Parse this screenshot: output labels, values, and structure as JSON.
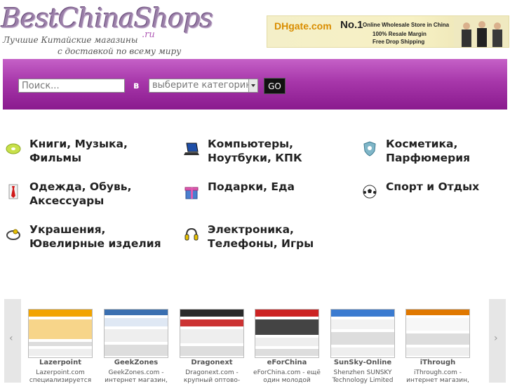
{
  "header": {
    "logo_title": "BestChinaShops",
    "logo_suffix": ".ru",
    "tagline_line1": "Лучшие Китайские магазины",
    "tagline_line2": "с доставкой по всему миру",
    "banner": {
      "brand": "DHgate.com",
      "rank": "No.1",
      "line1": "Online Wholesale Store in China",
      "line2": "100% Resale Margin",
      "line3": "Free Drop Shipping"
    }
  },
  "search": {
    "placeholder": "Поиск...",
    "in_label": "в",
    "category_placeholder": "выберите категорию",
    "go_label": "GO"
  },
  "categories": [
    {
      "label": "Книги, Музыка, Фильмы",
      "icon": "cd-disc-icon"
    },
    {
      "label": "Компьютеры, Ноутбуки, КПК",
      "icon": "laptop-icon"
    },
    {
      "label": "Косметика, Парфюмерия",
      "icon": "cosmetics-shield-icon"
    },
    {
      "label": "Одежда, Обувь, Аксессуары",
      "icon": "shirt-tie-icon"
    },
    {
      "label": "Подарки, Еда",
      "icon": "gift-box-icon"
    },
    {
      "label": "Спорт и Отдых",
      "icon": "soccer-ball-icon"
    },
    {
      "label": "Украшения, Ювелирные изделия",
      "icon": "jewelry-icon"
    },
    {
      "label": "Электроника, Телефоны, Игры",
      "icon": "headphones-icon"
    }
  ],
  "shops": [
    {
      "name": "Lazerpoint",
      "desc1": "Lazerpoint.com",
      "desc2": "специализируется",
      "accent": "#f2a400"
    },
    {
      "name": "GeekZones",
      "desc1": "GeekZones.com -",
      "desc2": "интернет магазин,",
      "accent": "#3a6fb0"
    },
    {
      "name": "Dragonext",
      "desc1": "Dragonext.com -",
      "desc2": "крупный оптово-",
      "accent": "#2a2a2a"
    },
    {
      "name": "eForChina",
      "desc1": "eForChina.com - ещё",
      "desc2": "один молодой",
      "accent": "#cc2222"
    },
    {
      "name": "SunSky-Online",
      "desc1": "Shenzhen SUNSKY",
      "desc2": "Technology Limited",
      "accent": "#3b7bd0"
    },
    {
      "name": "iThrough",
      "desc1": "iThrough.com -",
      "desc2": "интернет магазин,",
      "accent": "#e07800"
    }
  ],
  "carousel": {
    "prev": "‹",
    "next": "›"
  }
}
